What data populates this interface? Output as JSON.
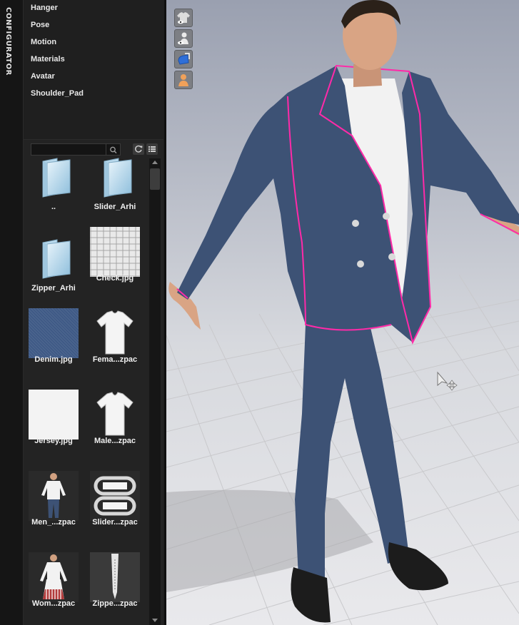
{
  "tab": {
    "label": "CONFIGURATOR"
  },
  "menu": {
    "items": [
      "Hanger",
      "Pose",
      "Motion",
      "Materials",
      "Avatar",
      "Shoulder_Pad"
    ]
  },
  "library": {
    "search": {
      "value": "",
      "placeholder": ""
    },
    "items": [
      {
        "label": "..",
        "icon": "folder-icon"
      },
      {
        "label": "Slider_Arhi",
        "icon": "folder-icon"
      },
      {
        "label": "Zipper_Arhi",
        "icon": "folder-icon"
      },
      {
        "label": "Check.jpg",
        "icon": "check-fabric-thumbnail"
      },
      {
        "label": "Denim.jpg",
        "icon": "denim-fabric-thumbnail"
      },
      {
        "label": "Fema...zpac",
        "icon": "tshirt-thumbnail"
      },
      {
        "label": "Jersey.jpg",
        "icon": "jersey-fabric-thumbnail"
      },
      {
        "label": "Male...zpac",
        "icon": "tshirt-thumbnail"
      },
      {
        "label": "Men_...zpac",
        "icon": "men-outfit-thumbnail"
      },
      {
        "label": "Slider...zpac",
        "icon": "slider-thumbnail"
      },
      {
        "label": "Wom...zpac",
        "icon": "women-outfit-thumbnail"
      },
      {
        "label": "Zippe...zpac",
        "icon": "zipper-thumbnail"
      }
    ]
  },
  "viewport": {
    "icons": [
      "garment-visibility-icon",
      "avatar-visibility-icon",
      "clothing-display-icon",
      "avatar-display-icon"
    ],
    "colors": {
      "denim": "#3d5275",
      "seam": "#ff2aa8",
      "shirt": "#f2f2f2",
      "skin": "#d9a484",
      "shoe": "#1c1c1c"
    }
  }
}
